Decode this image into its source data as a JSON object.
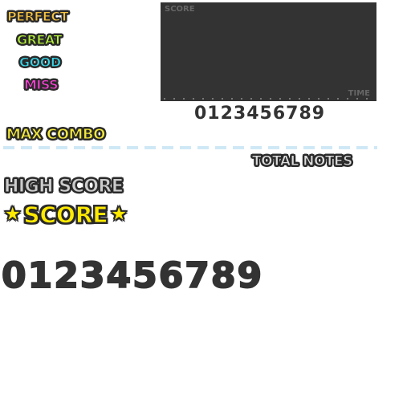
{
  "judgements": {
    "perfect": "PERFECT",
    "great": "GREAT",
    "good": "GOOD",
    "miss": "MISS"
  },
  "panel": {
    "score_label": "SCORE",
    "time_label": "TIME"
  },
  "digits": {
    "small": "0123456789",
    "large": "0123456789"
  },
  "labels": {
    "max_combo": "MAX COMBO",
    "total_notes": "TOTAL NOTES",
    "high_score": "HIGH SCORE",
    "score": "SCORE"
  },
  "icons": {
    "star_left": "star-icon",
    "star_right": "star-icon"
  },
  "colors": {
    "perfect": "#f5c242",
    "great": "#b6f23a",
    "good": "#37d6e8",
    "miss": "#ff3fd8",
    "max_combo": "#f2e83b",
    "total_notes": "#dddddd",
    "high_score": "#cccccc",
    "score": "#ffea00",
    "panel": "#333333",
    "dash": "#cfe8f6"
  }
}
